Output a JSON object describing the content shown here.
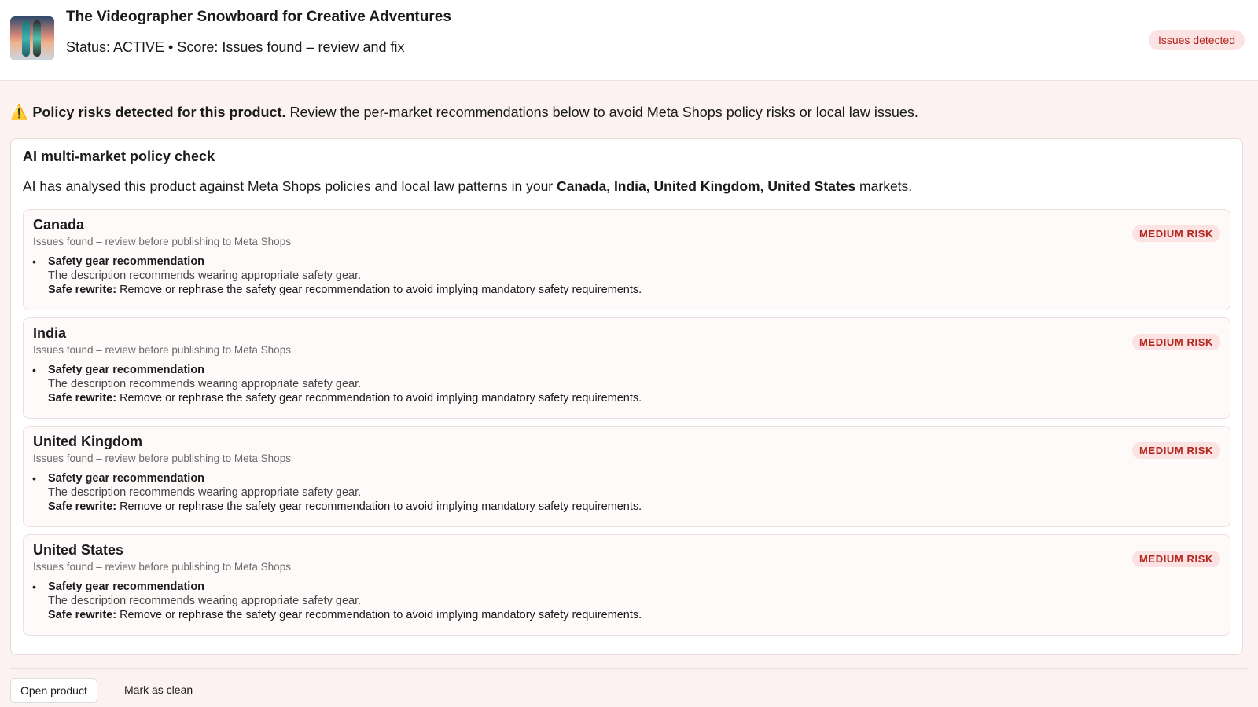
{
  "header": {
    "product_title": "The Videographer Snowboard for Creative Adventures",
    "status_line": "Status: ACTIVE • Score: Issues found – review and fix",
    "issues_badge": "Issues detected",
    "thumbnail_icon": "snowboard-thumbnail"
  },
  "warning": {
    "icon": "⚠️",
    "bold": "Policy risks detected for this product.",
    "text": " Review the per-market recommendations below to avoid Meta Shops policy risks or local law issues."
  },
  "card": {
    "title": "AI multi-market policy check",
    "desc_prefix": "AI has analysed this product against Meta Shops policies and local law patterns in your ",
    "desc_markets": "Canada, India, United Kingdom, United States",
    "desc_suffix": " markets."
  },
  "markets": [
    {
      "name": "Canada",
      "subtitle": "Issues found – review before publishing to Meta Shops",
      "risk": "MEDIUM RISK",
      "issue_title": "Safety gear recommendation",
      "issue_desc": "The description recommends wearing appropriate safety gear.",
      "rewrite_label": "Safe rewrite:",
      "rewrite_text": " Remove or rephrase the safety gear recommendation to avoid implying mandatory safety requirements."
    },
    {
      "name": "India",
      "subtitle": "Issues found – review before publishing to Meta Shops",
      "risk": "MEDIUM RISK",
      "issue_title": "Safety gear recommendation",
      "issue_desc": "The description recommends wearing appropriate safety gear.",
      "rewrite_label": "Safe rewrite:",
      "rewrite_text": " Remove or rephrase the safety gear recommendation to avoid implying mandatory safety requirements."
    },
    {
      "name": "United Kingdom",
      "subtitle": "Issues found – review before publishing to Meta Shops",
      "risk": "MEDIUM RISK",
      "issue_title": "Safety gear recommendation",
      "issue_desc": "The description recommends wearing appropriate safety gear.",
      "rewrite_label": "Safe rewrite:",
      "rewrite_text": " Remove or rephrase the safety gear recommendation to avoid implying mandatory safety requirements."
    },
    {
      "name": "United States",
      "subtitle": "Issues found – review before publishing to Meta Shops",
      "risk": "MEDIUM RISK",
      "issue_title": "Safety gear recommendation",
      "issue_desc": "The description recommends wearing appropriate safety gear.",
      "rewrite_label": "Safe rewrite:",
      "rewrite_text": " Remove or rephrase the safety gear recommendation to avoid implying mandatory safety requirements."
    }
  ],
  "actions": {
    "open_product": "Open product",
    "mark_clean": "Mark as clean"
  },
  "colors": {
    "risk_bg": "#fbe3e3",
    "risk_text": "#b3261e",
    "page_bg": "#fdf2f2"
  }
}
